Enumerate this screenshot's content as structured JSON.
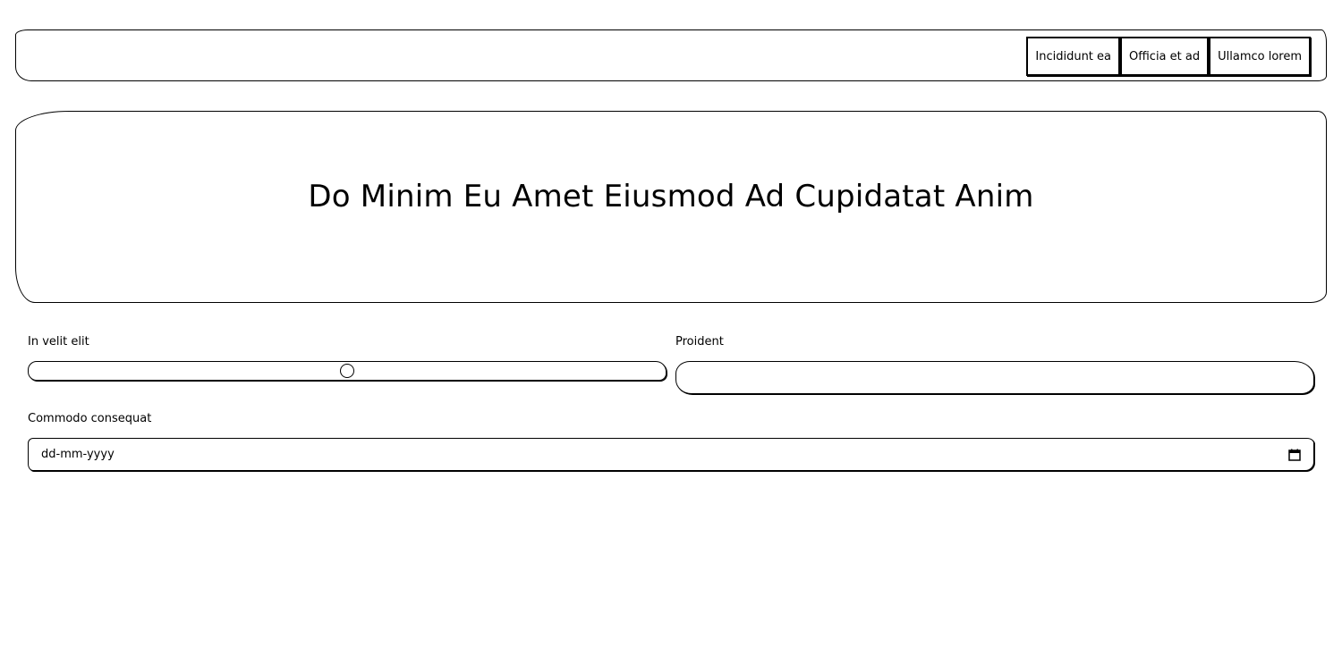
{
  "nav": {
    "links": [
      {
        "label": "Incididunt ea"
      },
      {
        "label": "Officia et ad"
      },
      {
        "label": "Ullamco lorem"
      }
    ]
  },
  "hero": {
    "title": "Do Minim Eu Amet Eiusmod Ad Cupidatat Anim"
  },
  "form": {
    "range": {
      "label": "In velit elit",
      "value": 0.5
    },
    "text": {
      "label": "Proident",
      "value": "",
      "placeholder": ""
    },
    "date": {
      "label": "Commodo consequat",
      "placeholder": "dd-mm-yyyy",
      "icon": "calendar-icon"
    }
  }
}
